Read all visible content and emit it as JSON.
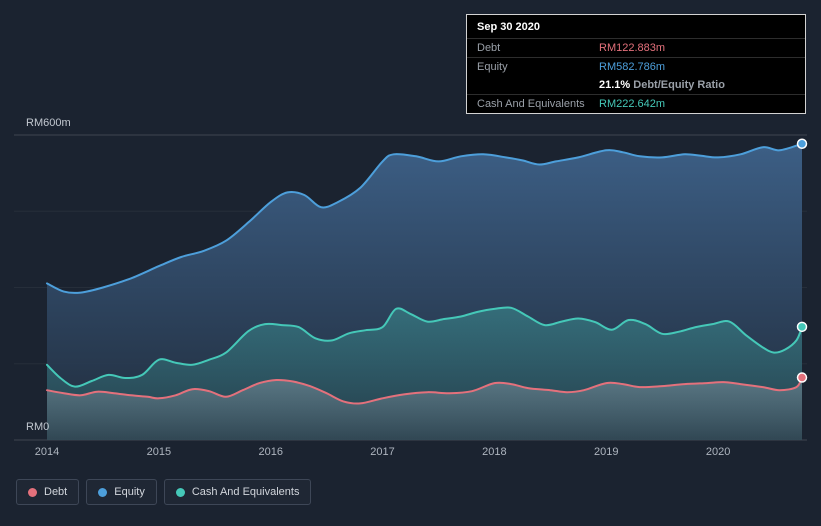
{
  "page": {
    "background": "#1b2330"
  },
  "tooltip": {
    "date": "Sep 30 2020",
    "debt_label": "Debt",
    "debt_value": "RM122.883m",
    "equity_label": "Equity",
    "equity_value": "RM582.786m",
    "ratio_value": "21.1%",
    "ratio_label": " Debt/Equity Ratio",
    "cash_label": "Cash And Equivalents",
    "cash_value": "RM222.642m"
  },
  "y_axis": {
    "top_label": "RM600m",
    "bottom_label": "RM0"
  },
  "legend": {
    "items": [
      {
        "label": "Debt",
        "color": "#e4717c"
      },
      {
        "label": "Equity",
        "color": "#4d9fdb"
      },
      {
        "label": "Cash And Equivalents",
        "color": "#45c8b8"
      }
    ]
  },
  "chart_data": {
    "type": "area",
    "title": "",
    "xlabel": "",
    "ylabel": "",
    "x_range": [
      2014,
      2020.75
    ],
    "ylim": [
      0,
      600
    ],
    "y_gridlines": [
      0,
      150,
      300,
      450,
      600
    ],
    "y_tick_labels": [
      "RM0",
      "RM600m"
    ],
    "x_ticks": [
      2014,
      2015,
      2016,
      2017,
      2018,
      2019,
      2020
    ],
    "grid": true,
    "legend_position": "bottom-left",
    "series": [
      {
        "name": "Equity",
        "color": "#4d9fdb",
        "fill_top": "rgba(62,98,138,0.95)",
        "fill_bottom": "rgba(33,45,61,0.9)",
        "points": [
          [
            2014.0,
            308
          ],
          [
            2014.15,
            292
          ],
          [
            2014.3,
            290
          ],
          [
            2014.5,
            300
          ],
          [
            2014.75,
            318
          ],
          [
            2015.0,
            342
          ],
          [
            2015.2,
            360
          ],
          [
            2015.4,
            372
          ],
          [
            2015.6,
            392
          ],
          [
            2015.8,
            428
          ],
          [
            2016.0,
            468
          ],
          [
            2016.15,
            487
          ],
          [
            2016.3,
            482
          ],
          [
            2016.45,
            458
          ],
          [
            2016.6,
            468
          ],
          [
            2016.8,
            496
          ],
          [
            2017.0,
            548
          ],
          [
            2017.1,
            562
          ],
          [
            2017.3,
            558
          ],
          [
            2017.5,
            548
          ],
          [
            2017.7,
            558
          ],
          [
            2017.9,
            562
          ],
          [
            2018.1,
            556
          ],
          [
            2018.25,
            550
          ],
          [
            2018.4,
            542
          ],
          [
            2018.55,
            548
          ],
          [
            2018.75,
            556
          ],
          [
            2019.0,
            570
          ],
          [
            2019.15,
            566
          ],
          [
            2019.3,
            558
          ],
          [
            2019.5,
            556
          ],
          [
            2019.7,
            562
          ],
          [
            2019.85,
            559
          ],
          [
            2020.0,
            556
          ],
          [
            2020.2,
            562
          ],
          [
            2020.4,
            576
          ],
          [
            2020.55,
            570
          ],
          [
            2020.75,
            582.786
          ]
        ]
      },
      {
        "name": "Cash And Equivalents",
        "color": "#45c8b8",
        "fill_top": "rgba(69,200,184,0.32)",
        "fill_bottom": "rgba(69,200,184,0.10)",
        "points": [
          [
            2014.0,
            148
          ],
          [
            2014.12,
            122
          ],
          [
            2014.25,
            105
          ],
          [
            2014.4,
            116
          ],
          [
            2014.55,
            128
          ],
          [
            2014.7,
            122
          ],
          [
            2014.85,
            128
          ],
          [
            2015.0,
            158
          ],
          [
            2015.15,
            152
          ],
          [
            2015.3,
            148
          ],
          [
            2015.45,
            158
          ],
          [
            2015.6,
            172
          ],
          [
            2015.8,
            214
          ],
          [
            2015.95,
            228
          ],
          [
            2016.1,
            226
          ],
          [
            2016.25,
            222
          ],
          [
            2016.4,
            200
          ],
          [
            2016.55,
            196
          ],
          [
            2016.7,
            210
          ],
          [
            2016.85,
            216
          ],
          [
            2017.0,
            222
          ],
          [
            2017.12,
            258
          ],
          [
            2017.25,
            248
          ],
          [
            2017.4,
            233
          ],
          [
            2017.55,
            238
          ],
          [
            2017.7,
            243
          ],
          [
            2017.85,
            252
          ],
          [
            2018.0,
            258
          ],
          [
            2018.15,
            260
          ],
          [
            2018.3,
            243
          ],
          [
            2018.45,
            226
          ],
          [
            2018.6,
            233
          ],
          [
            2018.75,
            239
          ],
          [
            2018.9,
            232
          ],
          [
            2019.05,
            217
          ],
          [
            2019.2,
            236
          ],
          [
            2019.35,
            228
          ],
          [
            2019.5,
            209
          ],
          [
            2019.65,
            213
          ],
          [
            2019.8,
            222
          ],
          [
            2019.95,
            228
          ],
          [
            2020.1,
            233
          ],
          [
            2020.25,
            206
          ],
          [
            2020.4,
            182
          ],
          [
            2020.5,
            172
          ],
          [
            2020.6,
            178
          ],
          [
            2020.7,
            196
          ],
          [
            2020.75,
            222.642
          ]
        ]
      },
      {
        "name": "Debt",
        "color": "#e4717c",
        "fill_top": "rgba(196,200,212,0.30)",
        "fill_bottom": "rgba(196,200,212,0.08)",
        "points": [
          [
            2014.0,
            98
          ],
          [
            2014.15,
            92
          ],
          [
            2014.3,
            88
          ],
          [
            2014.45,
            95
          ],
          [
            2014.6,
            92
          ],
          [
            2014.75,
            88
          ],
          [
            2014.9,
            85
          ],
          [
            2015.0,
            82
          ],
          [
            2015.15,
            88
          ],
          [
            2015.3,
            100
          ],
          [
            2015.45,
            96
          ],
          [
            2015.6,
            85
          ],
          [
            2015.75,
            98
          ],
          [
            2015.9,
            112
          ],
          [
            2016.05,
            118
          ],
          [
            2016.2,
            115
          ],
          [
            2016.35,
            106
          ],
          [
            2016.5,
            92
          ],
          [
            2016.65,
            76
          ],
          [
            2016.8,
            72
          ],
          [
            2017.0,
            82
          ],
          [
            2017.2,
            90
          ],
          [
            2017.4,
            94
          ],
          [
            2017.6,
            92
          ],
          [
            2017.8,
            96
          ],
          [
            2018.0,
            112
          ],
          [
            2018.15,
            110
          ],
          [
            2018.3,
            102
          ],
          [
            2018.5,
            98
          ],
          [
            2018.65,
            94
          ],
          [
            2018.8,
            98
          ],
          [
            2019.0,
            112
          ],
          [
            2019.15,
            110
          ],
          [
            2019.3,
            104
          ],
          [
            2019.5,
            106
          ],
          [
            2019.7,
            110
          ],
          [
            2019.9,
            112
          ],
          [
            2020.05,
            114
          ],
          [
            2020.2,
            110
          ],
          [
            2020.4,
            104
          ],
          [
            2020.55,
            98
          ],
          [
            2020.7,
            104
          ],
          [
            2020.75,
            122.883
          ]
        ]
      }
    ]
  }
}
